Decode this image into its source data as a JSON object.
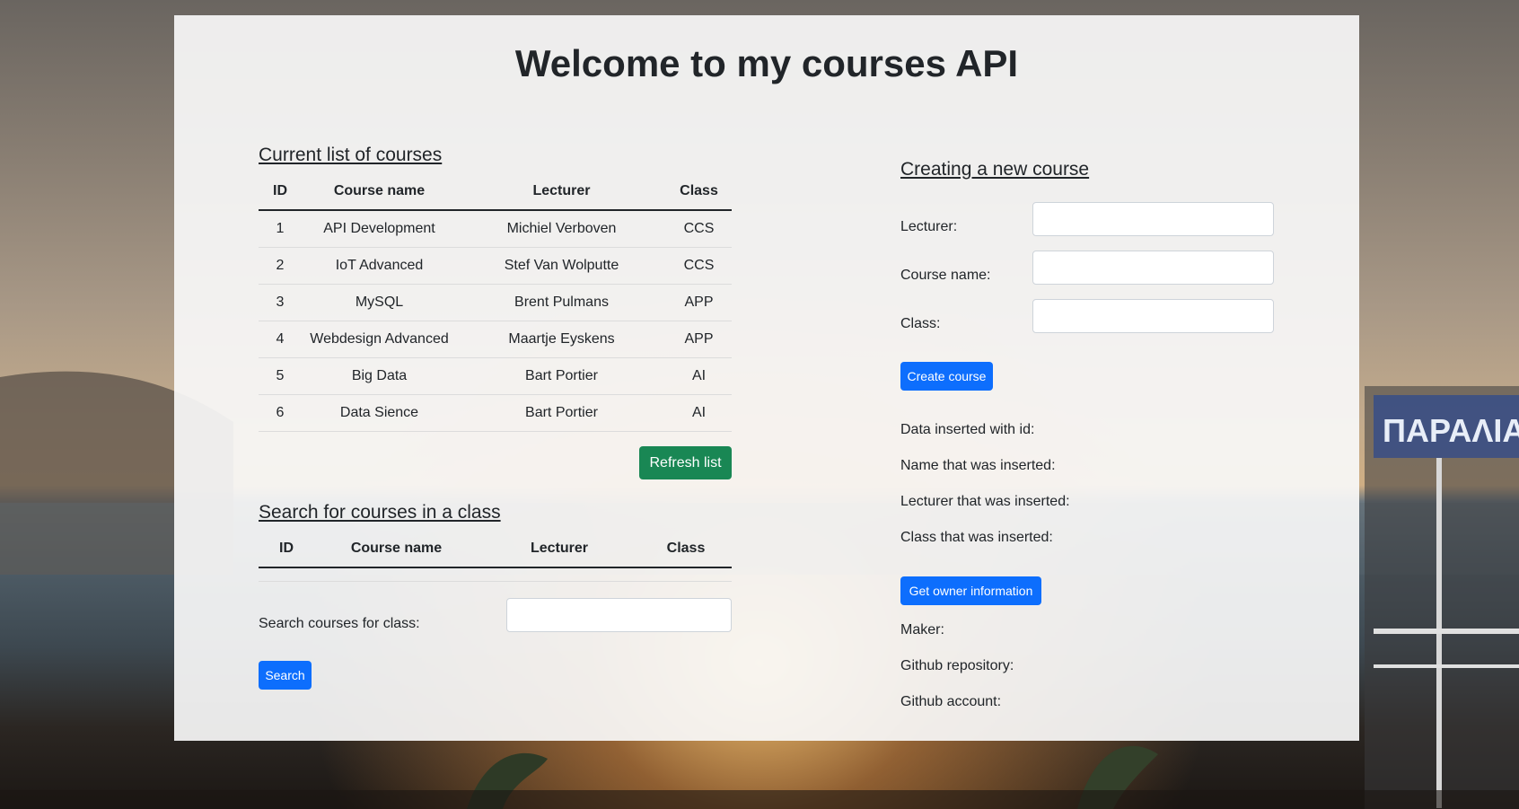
{
  "page_title": "Welcome to my courses API",
  "course_list": {
    "heading": "Current list of courses",
    "columns": [
      "ID",
      "Course name",
      "Lecturer",
      "Class"
    ],
    "rows": [
      [
        "1",
        "API Development",
        "Michiel Verboven",
        "CCS"
      ],
      [
        "2",
        "IoT Advanced",
        "Stef Van Wolputte",
        "CCS"
      ],
      [
        "3",
        "MySQL",
        "Brent Pulmans",
        "APP"
      ],
      [
        "4",
        "Webdesign Advanced",
        "Maartje Eyskens",
        "APP"
      ],
      [
        "5",
        "Big Data",
        "Bart Portier",
        "AI"
      ],
      [
        "6",
        "Data Sience",
        "Bart Portier",
        "AI"
      ]
    ],
    "refresh_label": "Refresh list"
  },
  "search": {
    "heading": "Search for courses in a class",
    "columns": [
      "ID",
      "Course name",
      "Lecturer",
      "Class"
    ],
    "input_label": "Search courses for class:",
    "input_value": "",
    "button_label": "Search"
  },
  "create": {
    "heading": "Creating a new course",
    "lecturer_label": "Lecturer:",
    "lecturer_value": "",
    "course_name_label": "Course name:",
    "course_name_value": "",
    "class_label": "Class:",
    "class_value": "",
    "button_label": "Create course",
    "result_id_label": "Data inserted with id:",
    "result_name_label": "Name that was inserted:",
    "result_lecturer_label": "Lecturer that was inserted:",
    "result_class_label": "Class that was inserted:"
  },
  "owner": {
    "button_label": "Get owner information",
    "maker_label": "Maker:",
    "repo_label": "Github repository:",
    "account_label": "Github account:"
  },
  "background": {
    "sign_text": "ΠΑΡΑΛΙΑ"
  },
  "colors": {
    "primary": "#0d6efd",
    "success": "#198754",
    "panel": "#f8f8f8"
  }
}
